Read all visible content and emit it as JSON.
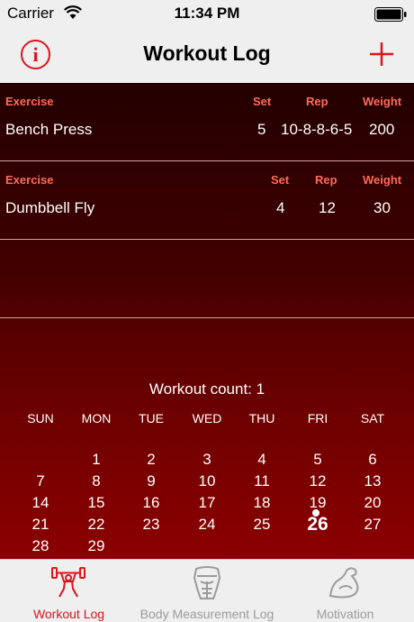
{
  "status_bar": {
    "carrier": "Carrier",
    "time": "11:34 PM"
  },
  "nav": {
    "title": "Workout Log",
    "info_glyph": "i"
  },
  "entries": [
    {
      "headers": {
        "exercise": "Exercise",
        "set": "Set",
        "rep": "Rep",
        "weight": "Weight"
      },
      "exercise": "Bench Press",
      "set": "5",
      "rep": "10-8-8-6-5",
      "weight": "200"
    },
    {
      "headers": {
        "exercise": "Exercise",
        "set": "Set",
        "rep": "Rep",
        "weight": "Weight"
      },
      "exercise": "Dumbbell Fly",
      "set": "4",
      "rep": "12",
      "weight": "30"
    }
  ],
  "workout_count": "Workout count: 1",
  "calendar": {
    "weekdays": [
      "SUN",
      "MON",
      "TUE",
      "WED",
      "THU",
      "FRI",
      "SAT"
    ],
    "weeks": [
      [
        "",
        "1",
        "2",
        "3",
        "4",
        "5",
        "6"
      ],
      [
        "7",
        "8",
        "9",
        "10",
        "11",
        "12",
        "13"
      ],
      [
        "14",
        "15",
        "16",
        "17",
        "18",
        "19",
        "20"
      ],
      [
        "21",
        "22",
        "23",
        "24",
        "25",
        "26",
        "27"
      ],
      [
        "28",
        "29",
        "",
        "",
        "",
        "",
        ""
      ]
    ],
    "today": "26"
  },
  "tabs": [
    {
      "label": "Workout Log",
      "icon": "weightlifter-icon",
      "active": true
    },
    {
      "label": "Body Measurement Log",
      "icon": "body-measurement-icon",
      "active": false
    },
    {
      "label": "Motivation",
      "icon": "flexed-arm-icon",
      "active": false
    }
  ],
  "colors": {
    "accent": "#e0121a",
    "header_text": "#ff6a5a",
    "inactive_tab": "#9b9b9b"
  }
}
